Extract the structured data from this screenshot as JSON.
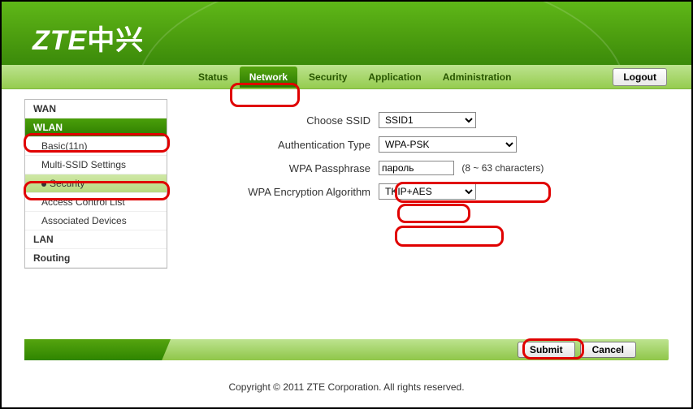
{
  "brand": {
    "en": "ZTE",
    "cn": "中兴"
  },
  "tabs": {
    "status": "Status",
    "network": "Network",
    "security": "Security",
    "application": "Application",
    "administration": "Administration"
  },
  "logout": "Logout",
  "sidebar": {
    "wan": "WAN",
    "wlan": "WLAN",
    "basic": "Basic(11n)",
    "multi_ssid": "Multi-SSID Settings",
    "security": "Security",
    "acl": "Access Control List",
    "assoc": "Associated Devices",
    "lan": "LAN",
    "routing": "Routing"
  },
  "form": {
    "choose_ssid_label": "Choose SSID",
    "choose_ssid_value": "SSID1",
    "auth_type_label": "Authentication Type",
    "auth_type_value": "WPA-PSK",
    "passphrase_label": "WPA Passphrase",
    "passphrase_value": "пароль",
    "passphrase_hint": "(8 ~ 63 characters)",
    "encryption_label": "WPA Encryption Algorithm",
    "encryption_value": "TKIP+AES"
  },
  "buttons": {
    "submit": "Submit",
    "cancel": "Cancel"
  },
  "footer": "Copyright © 2011 ZTE Corporation. All rights reserved."
}
